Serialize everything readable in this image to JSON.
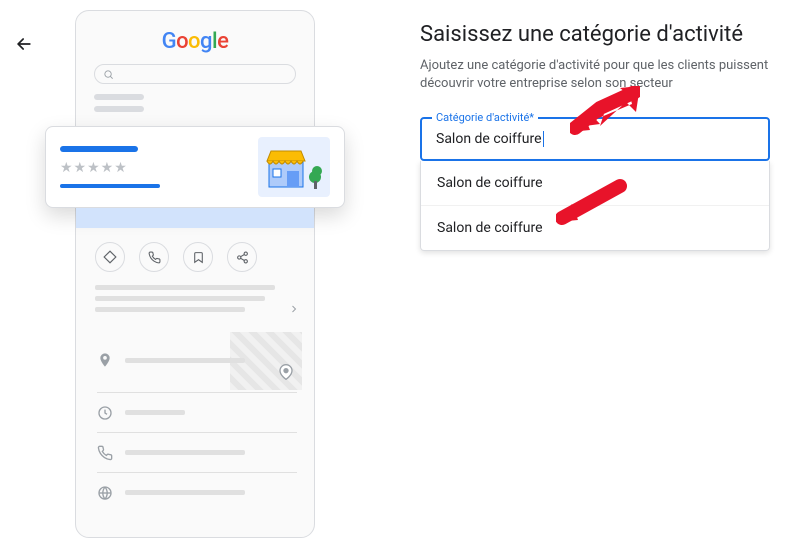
{
  "back_button": "back",
  "logo": {
    "letters": [
      "G",
      "o",
      "o",
      "g",
      "l",
      "e"
    ]
  },
  "form": {
    "heading": "Saisissez une catégorie d'activité",
    "subtext": "Ajoutez une catégorie d'activité pour que les clients puissent découvrir votre entreprise selon son secteur",
    "field_label": "Catégorie d'activité*",
    "field_value": "Salon de coiffure",
    "suggestions": [
      "Salon de coiffure",
      "Salon de coiffure"
    ]
  },
  "phone_actions": [
    "diamond",
    "call",
    "bookmark",
    "share"
  ],
  "list_icons": [
    "location",
    "clock",
    "phone",
    "globe"
  ],
  "stars": "★★★★★"
}
